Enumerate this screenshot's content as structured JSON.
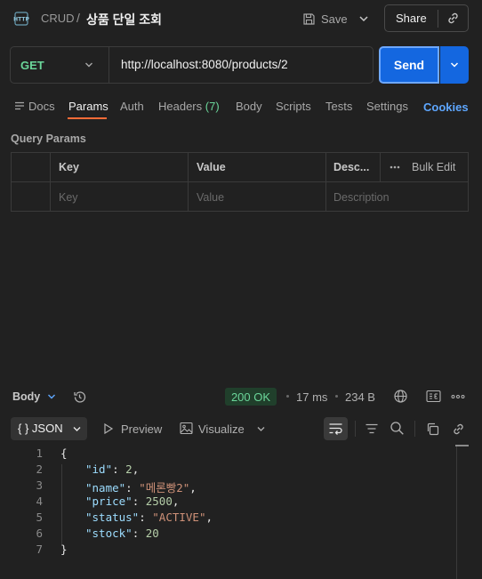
{
  "header": {
    "http_icon": "http-icon",
    "collection": "CRUD",
    "separator": "/",
    "request_name": "상품 단일 조회",
    "save_label": "Save",
    "share_label": "Share"
  },
  "request": {
    "method": "GET",
    "url": "http://localhost:8080/products/2",
    "send_label": "Send"
  },
  "tabs": [
    {
      "label": "Docs"
    },
    {
      "label": "Params",
      "active": true
    },
    {
      "label": "Auth"
    },
    {
      "label": "Headers",
      "count": "(7)"
    },
    {
      "label": "Body"
    },
    {
      "label": "Scripts"
    },
    {
      "label": "Tests"
    },
    {
      "label": "Settings"
    }
  ],
  "cookies_label": "Cookies",
  "query_params": {
    "title": "Query Params",
    "headers": [
      "Key",
      "Value",
      "Desc..."
    ],
    "bulk_edit": "Bulk Edit",
    "placeholders": [
      "Key",
      "Value",
      "Description"
    ]
  },
  "response": {
    "body_label": "Body",
    "status": "200 OK",
    "time": "17 ms",
    "size": "234 B",
    "format": "{ } JSON",
    "preview_label": "Preview",
    "visualize_label": "Visualize",
    "lines": [
      {
        "n": "1",
        "text": "{"
      },
      {
        "n": "2",
        "key": "\"id\"",
        "value": "2",
        "type": "num",
        "comma": true
      },
      {
        "n": "3",
        "key": "\"name\"",
        "value": "\"메론빵2\"",
        "type": "str",
        "comma": true
      },
      {
        "n": "4",
        "key": "\"price\"",
        "value": "2500",
        "type": "num",
        "comma": true
      },
      {
        "n": "5",
        "key": "\"status\"",
        "value": "\"ACTIVE\"",
        "type": "str",
        "comma": true
      },
      {
        "n": "6",
        "key": "\"stock\"",
        "value": "20",
        "type": "num",
        "comma": false
      },
      {
        "n": "7",
        "text": "}"
      }
    ]
  },
  "colors": {
    "accent": "#1467e0",
    "method_get": "#6bd69a",
    "tab_underline": "#ff6c37",
    "cookies": "#5ea7ff"
  }
}
